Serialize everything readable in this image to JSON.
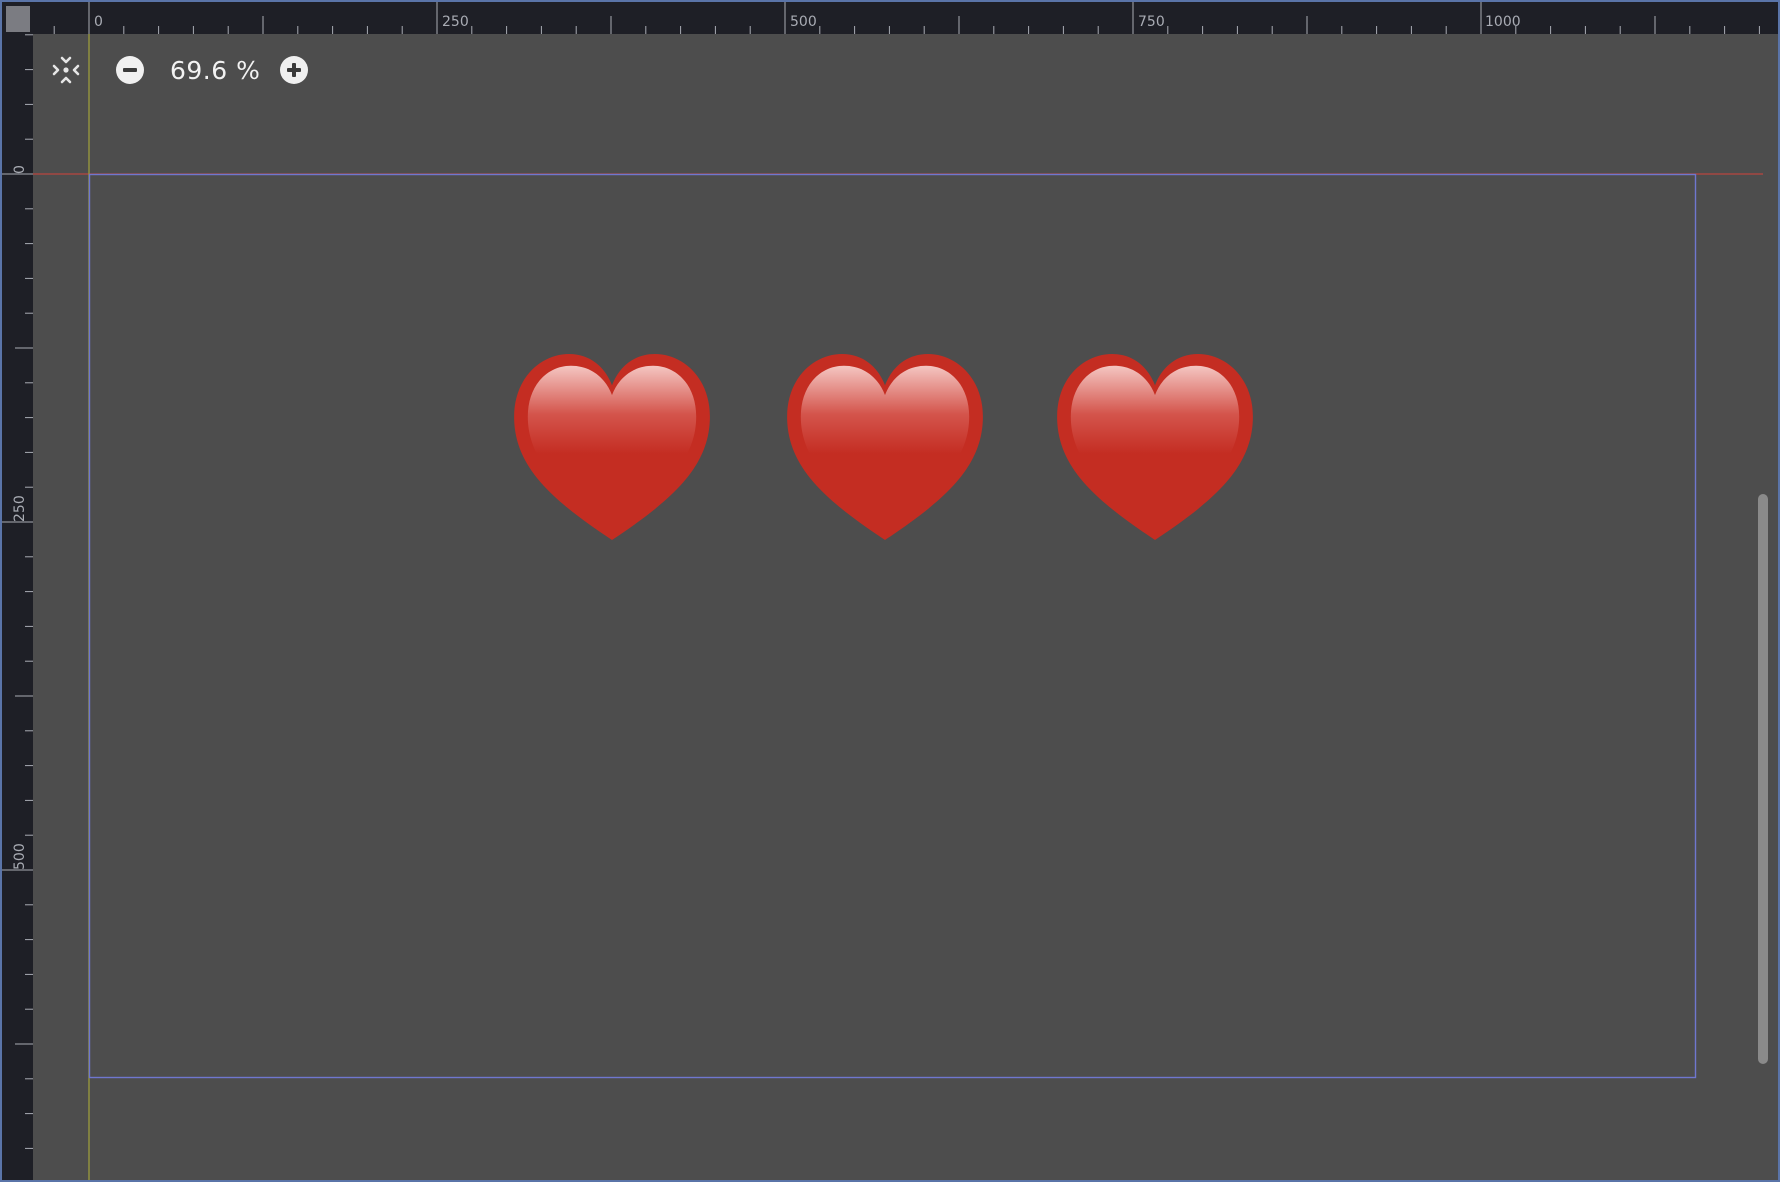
{
  "zoom": {
    "label": "69.6 %",
    "value_percent": 69.6
  },
  "toolbar": {
    "fit_icon": "center-view-icon",
    "zoom_out_icon": "zoom-out-icon",
    "zoom_in_icon": "zoom-in-icon"
  },
  "rulers": {
    "top_labels": [
      "0",
      "250",
      "500",
      "750",
      "1000"
    ],
    "left_labels": [
      "0",
      "250",
      "500"
    ]
  },
  "scene": {
    "items": [
      {
        "name": "heart-1",
        "icon": "heart-icon"
      },
      {
        "name": "heart-2",
        "icon": "heart-icon"
      },
      {
        "name": "heart-3",
        "icon": "heart-icon"
      }
    ]
  },
  "colors": {
    "canvas_bg": "#4d4d4d",
    "ruler_bg": "#1e1f26",
    "viewport_rect": "#6f77cf",
    "x_axis": "#b8463f",
    "y_axis": "#a2a23b",
    "heart": "#c42d22"
  }
}
